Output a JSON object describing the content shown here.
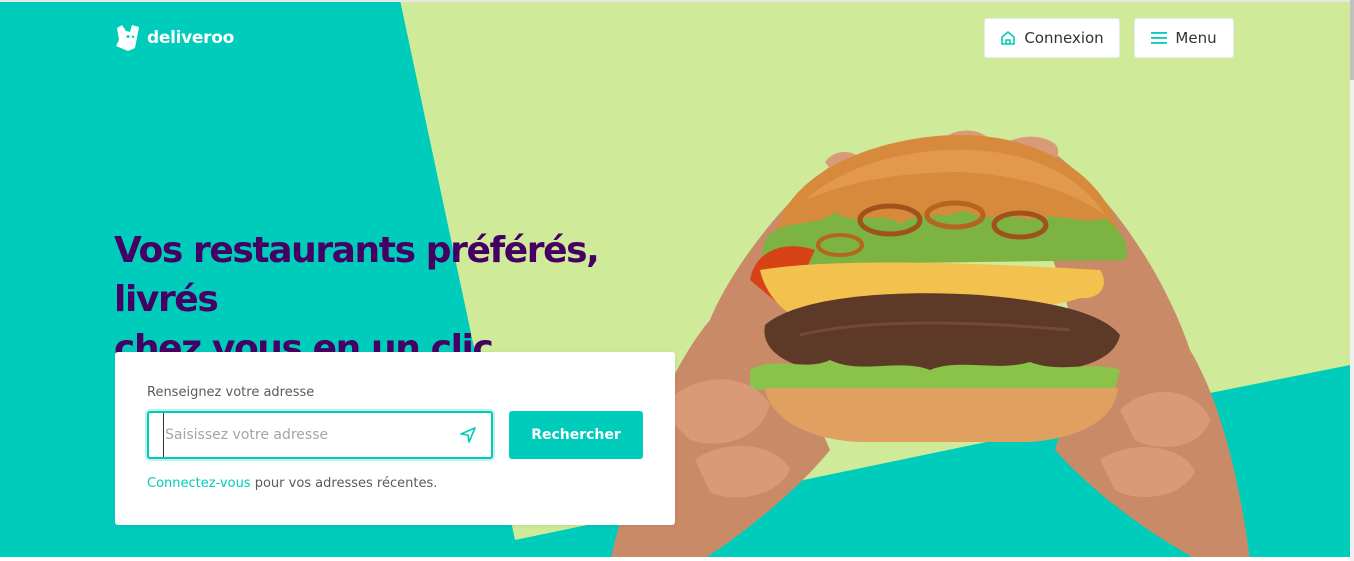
{
  "brand": {
    "name": "deliveroo",
    "logo_icon": "kangaroo-icon"
  },
  "header": {
    "login_label": "Connexion",
    "login_icon": "home-icon",
    "menu_label": "Menu",
    "menu_icon": "hamburger-icon"
  },
  "hero": {
    "headline_line1": "Vos restaurants préférés, livrés",
    "headline_line2": "chez vous en un clic"
  },
  "address_form": {
    "label": "Renseignez votre adresse",
    "placeholder": "Saisissez votre adresse",
    "value": "",
    "locate_icon": "location-arrow-icon",
    "search_label": "Rechercher",
    "login_link": "Connectez-vous",
    "login_suffix": " pour vos adresses récentes."
  },
  "colors": {
    "teal": "#00ccbc",
    "lime": "#cfeb99",
    "purple": "#440063",
    "white": "#ffffff"
  }
}
